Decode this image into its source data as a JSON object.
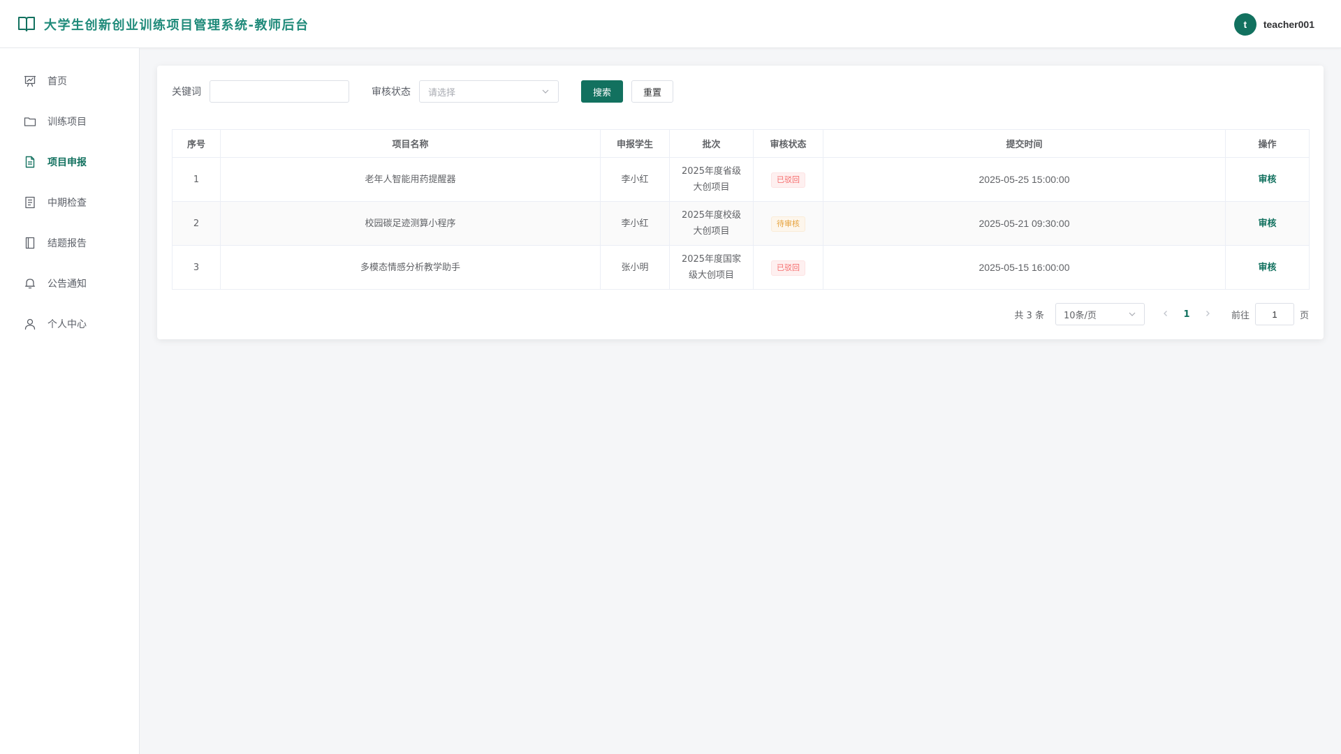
{
  "header": {
    "title": "大学生创新创业训练项目管理系统-教师后台",
    "logo_icon": "book-open-icon",
    "avatar_letter": "t",
    "username": "teacher001",
    "brand_color": "#12715f"
  },
  "sidebar": {
    "items": [
      {
        "label": "首页",
        "icon": "presentation-chart-icon",
        "active": false
      },
      {
        "label": "训练项目",
        "icon": "folder-icon",
        "active": false
      },
      {
        "label": "项目申报",
        "icon": "document-icon",
        "active": true
      },
      {
        "label": "中期检查",
        "icon": "checklist-icon",
        "active": false
      },
      {
        "label": "结题报告",
        "icon": "notebook-icon",
        "active": false
      },
      {
        "label": "公告通知",
        "icon": "bell-icon",
        "active": false
      },
      {
        "label": "个人中心",
        "icon": "user-icon",
        "active": false
      }
    ]
  },
  "filters": {
    "keyword_label": "关键词",
    "keyword_value": "",
    "status_label": "审核状态",
    "status_placeholder": "请选择",
    "search_label": "搜索",
    "reset_label": "重置"
  },
  "table": {
    "columns": [
      "序号",
      "项目名称",
      "申报学生",
      "批次",
      "审核状态",
      "提交时间",
      "操作"
    ],
    "rows": [
      {
        "index": "1",
        "name": "老年人智能用药提醒器",
        "student": "李小红",
        "batch_line1": "2025年度省级",
        "batch_line2": "大创项目",
        "status": "已驳回",
        "status_type": "rejected",
        "time": "2025-05-25 15:00:00",
        "action": "审核"
      },
      {
        "index": "2",
        "name": "校园碳足迹测算小程序",
        "student": "李小红",
        "batch_line1": "2025年度校级",
        "batch_line2": "大创项目",
        "status": "待审核",
        "status_type": "pending",
        "time": "2025-05-21 09:30:00",
        "action": "审核"
      },
      {
        "index": "3",
        "name": "多模态情感分析教学助手",
        "student": "张小明",
        "batch_line1": "2025年度国家",
        "batch_line2": "级大创项目",
        "status": "已驳回",
        "status_type": "rejected",
        "time": "2025-05-15 16:00:00",
        "action": "审核"
      }
    ]
  },
  "pagination": {
    "total_text": "共 3 条",
    "page_size": "10条/页",
    "current_page": "1",
    "goto_label": "前往",
    "goto_value": "1",
    "page_suffix": "页"
  }
}
